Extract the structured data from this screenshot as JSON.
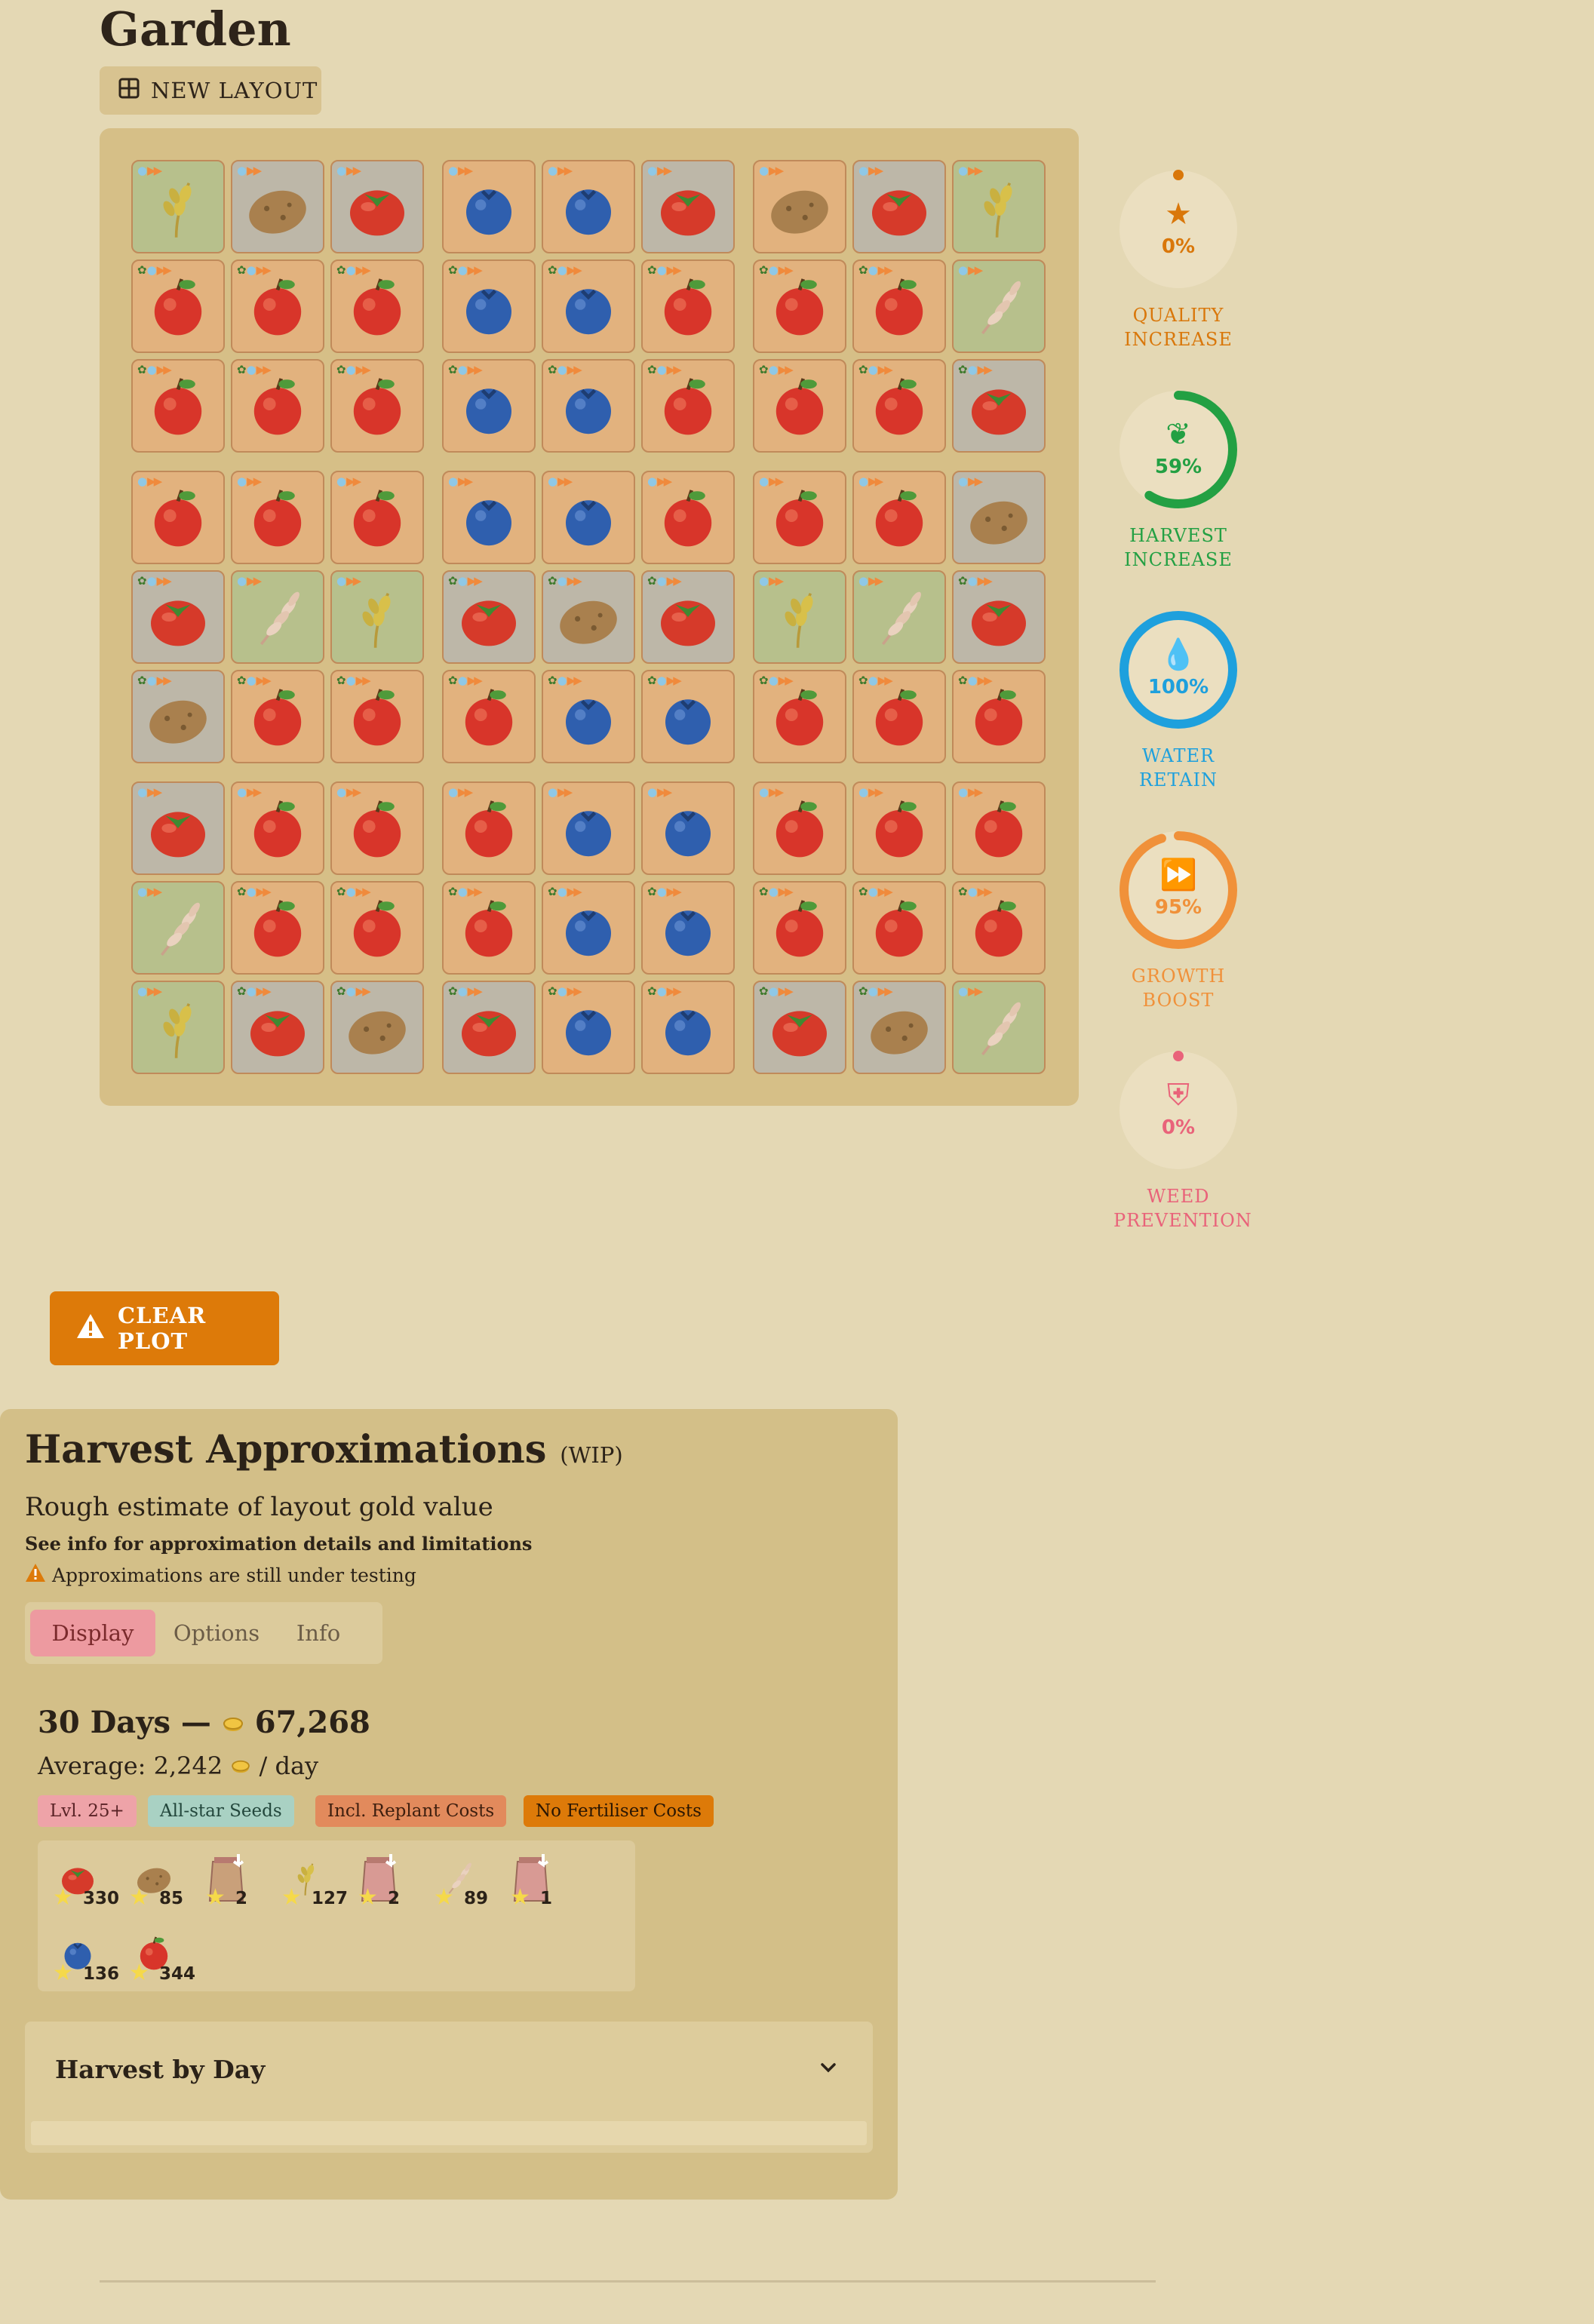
{
  "title": "Garden",
  "new_layout_label": "NEW LAYOUT",
  "grid": {
    "rows": [
      [
        "wheat",
        "potato",
        "tomato",
        "blueberry",
        "blueberry",
        "tomato",
        "potato",
        "tomato",
        "wheat"
      ],
      [
        "apple",
        "apple",
        "apple",
        "blueberry",
        "blueberry",
        "apple",
        "apple",
        "apple",
        "rice"
      ],
      [
        "apple",
        "apple",
        "apple",
        "blueberry",
        "blueberry",
        "apple",
        "apple",
        "apple",
        "tomato"
      ],
      [
        "apple",
        "apple",
        "apple",
        "blueberry",
        "blueberry",
        "apple",
        "apple",
        "apple",
        "potato"
      ],
      [
        "tomato",
        "rice",
        "wheat",
        "tomato",
        "potato",
        "tomato",
        "wheat",
        "rice",
        "tomato"
      ],
      [
        "potato",
        "apple",
        "apple",
        "apple",
        "blueberry",
        "blueberry",
        "apple",
        "apple",
        "apple"
      ],
      [
        "tomato",
        "apple",
        "apple",
        "apple",
        "blueberry",
        "blueberry",
        "apple",
        "apple",
        "apple"
      ],
      [
        "rice",
        "apple",
        "apple",
        "apple",
        "blueberry",
        "blueberry",
        "apple",
        "apple",
        "apple"
      ],
      [
        "wheat",
        "tomato",
        "potato",
        "tomato",
        "blueberry",
        "blueberry",
        "tomato",
        "potato",
        "rice"
      ]
    ],
    "bg": [
      [
        "grass",
        "stone",
        "stone",
        "soil",
        "soil",
        "stone",
        "soil",
        "stone",
        "grass"
      ],
      [
        "soil",
        "soil",
        "soil",
        "soil",
        "soil",
        "soil",
        "soil",
        "soil",
        "grass"
      ],
      [
        "soil",
        "soil",
        "soil",
        "soil",
        "soil",
        "soil",
        "soil",
        "soil",
        "stone"
      ],
      [
        "soil",
        "soil",
        "soil",
        "soil",
        "soil",
        "soil",
        "soil",
        "soil",
        "stone"
      ],
      [
        "stone",
        "grass",
        "grass",
        "stone",
        "stone",
        "stone",
        "grass",
        "grass",
        "stone"
      ],
      [
        "stone",
        "soil",
        "soil",
        "soil",
        "soil",
        "soil",
        "soil",
        "soil",
        "soil"
      ],
      [
        "stone",
        "soil",
        "soil",
        "soil",
        "soil",
        "soil",
        "soil",
        "soil",
        "soil"
      ],
      [
        "grass",
        "soil",
        "soil",
        "soil",
        "soil",
        "soil",
        "soil",
        "soil",
        "soil"
      ],
      [
        "grass",
        "stone",
        "stone",
        "stone",
        "soil",
        "soil",
        "stone",
        "stone",
        "grass"
      ]
    ]
  },
  "stats": [
    {
      "label_1": "QUALITY",
      "label_2": "INCREASE",
      "value": "0%",
      "fraction": 0,
      "color": "#d9770a",
      "icon": "star-icon"
    },
    {
      "label_1": "HARVEST",
      "label_2": "INCREASE",
      "value": "59%",
      "fraction": 0.59,
      "color": "#23a043",
      "icon": "leaf-icon"
    },
    {
      "label_1": "WATER",
      "label_2": "RETAIN",
      "value": "100%",
      "fraction": 1,
      "color": "#1ea0dd",
      "icon": "water-drop-icon"
    },
    {
      "label_1": "GROWTH",
      "label_2": "BOOST",
      "value": "95%",
      "fraction": 0.95,
      "color": "#f0913a",
      "icon": "fast-forward-icon"
    },
    {
      "label_1": "WEED",
      "label_2": "PREVENTION",
      "value": "0%",
      "fraction": 0,
      "color": "#e9637a",
      "icon": "shield-icon"
    }
  ],
  "clear_plot_label": "CLEAR PLOT",
  "harvest": {
    "title": "Harvest Approximations",
    "title_suffix": "(WIP)",
    "subtitle": "Rough estimate of layout gold value",
    "note": "See info for approximation details and limitations",
    "warning": "Approximations are still under testing",
    "tabs": [
      "Display",
      "Options",
      "Info"
    ],
    "active_tab": "Display",
    "days_label": "30 Days —",
    "total_gold": "67,268",
    "average_prefix": "Average: 2,242",
    "average_suffix": "/ day",
    "chips": [
      {
        "label": "Lvl. 25+",
        "bg": "#eea3a8",
        "fg": "#5a2326"
      },
      {
        "label": "All-star Seeds",
        "bg": "#a9d1c3",
        "fg": "#23473c"
      },
      {
        "label": "Incl. Replant Costs",
        "bg": "#e28a5c",
        "fg": "#3d1e0e"
      },
      {
        "label": "No Fertiliser Costs",
        "bg": "#dd7a09",
        "fg": "#2a1603"
      }
    ],
    "items": [
      {
        "icon": "tomato-icon",
        "count": "330"
      },
      {
        "icon": "potato-icon",
        "count": "85"
      },
      {
        "icon": "potato-seed-bag-icon",
        "count": "2"
      },
      {
        "icon": "wheat-icon",
        "count": "127"
      },
      {
        "icon": "wheat-seed-bag-icon",
        "count": "2"
      },
      {
        "icon": "rice-icon",
        "count": "89"
      },
      {
        "icon": "rice-seed-bag-icon",
        "count": "1"
      },
      {
        "icon": "blueberry-icon",
        "count": "136"
      },
      {
        "icon": "apple-icon",
        "count": "344"
      }
    ],
    "harvest_by_day_label": "Harvest by Day"
  }
}
